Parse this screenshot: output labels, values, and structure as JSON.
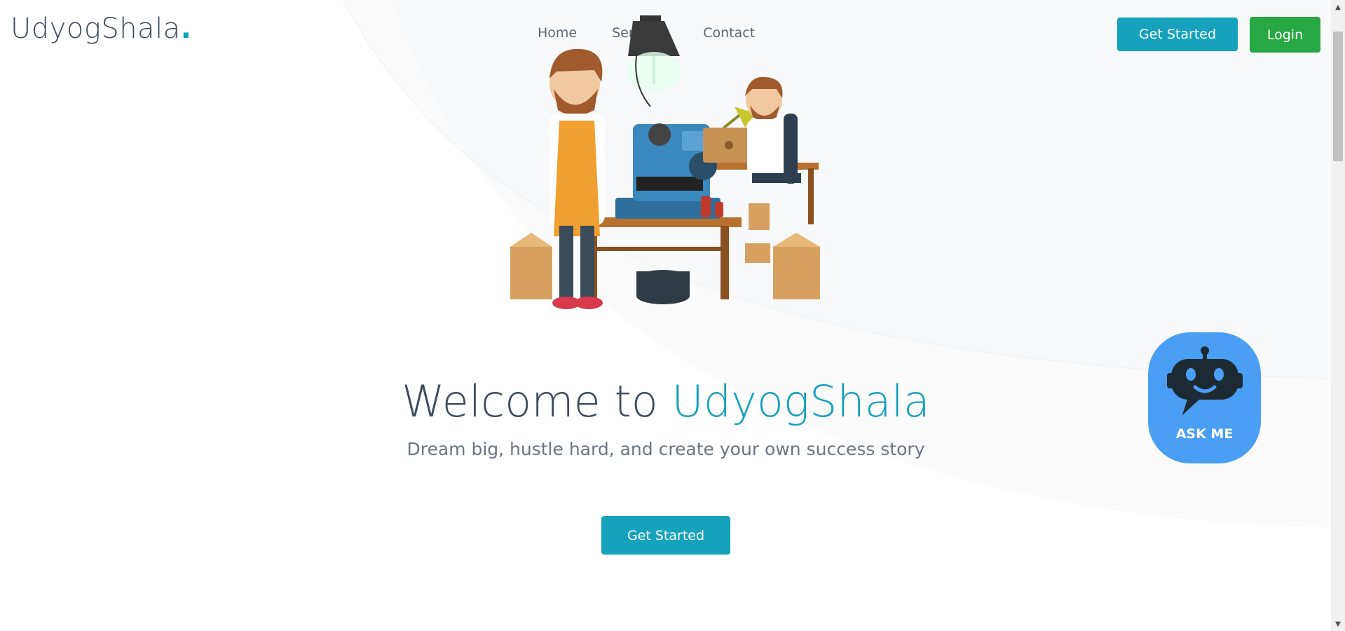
{
  "header": {
    "logo_text": "UdyogShala",
    "logo_dot": ".",
    "nav": [
      {
        "label": "Home"
      },
      {
        "label": "Services"
      },
      {
        "label": "Contact"
      }
    ],
    "get_started_label": "Get Started",
    "login_label": "Login"
  },
  "hero": {
    "title_prefix": "Welcome to ",
    "title_accent": "UdyogShala",
    "subtitle": "Dream big, hustle hard, and create your own success story",
    "cta_label": "Get Started",
    "illustration": "workshop-illustration"
  },
  "chatbot": {
    "label": "ASK ME",
    "icon": "robot-icon"
  },
  "colors": {
    "accent": "#16a2bd",
    "login": "#28a745",
    "text_dark": "#3d4b5e",
    "chatbot_bg": "#4a9ff5"
  }
}
